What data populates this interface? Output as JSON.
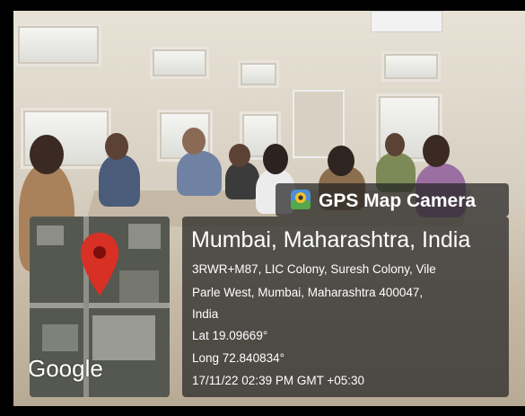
{
  "overlay": {
    "app_name": "GPS Map Camera",
    "location_title": "Mumbai, Maharashtra, India",
    "address_line1": "3RWR+M87, LIC Colony, Suresh Colony, Vile",
    "address_line2": "Parle West, Mumbai, Maharashtra 400047,",
    "address_line3": "India",
    "latitude": "Lat 19.09669°",
    "longitude": "Long 72.840834°",
    "timestamp": "17/11/22 02:39 PM GMT +05:30",
    "map_attribution": "Google",
    "pin_color": "#d93025",
    "panel_color": "#232323"
  },
  "icons": {
    "brand": "gps-map-camera-icon",
    "pin": "map-pin-icon"
  }
}
